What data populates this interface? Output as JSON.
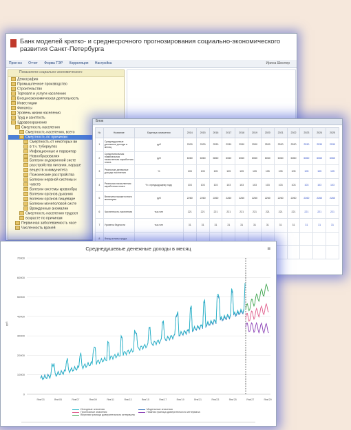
{
  "tree_window": {
    "title": "Банк моделей кратко- и среднесрочного прогнозирования социально-экономического развития Санкт-Петербурга",
    "menu": [
      "Прогноз",
      "Отчет",
      "Форма ТЭР",
      "Корреляция",
      "Настройка"
    ],
    "user": "Ирина Шихлер",
    "tree_header": "Показатели социально-экономического",
    "nodes": [
      {
        "label": "Демография",
        "level": 0
      },
      {
        "label": "Промышленное производство",
        "level": 0
      },
      {
        "label": "Строительство",
        "level": 0
      },
      {
        "label": "Торговля и услуги населению",
        "level": 0
      },
      {
        "label": "Внешнеэкономическая деятельность",
        "level": 0
      },
      {
        "label": "Инвестиции",
        "level": 0
      },
      {
        "label": "Финансы",
        "level": 0
      },
      {
        "label": "Уровень жизни населения",
        "level": 0
      },
      {
        "label": "Труд и занятость",
        "level": 0
      },
      {
        "label": "Здравоохранение",
        "level": 0
      },
      {
        "label": "Смертность населения",
        "level": 1
      },
      {
        "label": "Смертность населения, всего",
        "level": 2
      },
      {
        "label": "Смертность по причинам",
        "level": 2,
        "selected": true
      },
      {
        "label": "Смертность от некоторых ви",
        "level": 3
      },
      {
        "label": "в т.ч. туберкулез",
        "level": 3
      },
      {
        "label": "Инфекционные и паразитар",
        "level": 3
      },
      {
        "label": "Новообразования",
        "level": 3
      },
      {
        "label": "Болезни эндокринной систе",
        "level": 3
      },
      {
        "label": "расстройства питания, наруше",
        "level": 3
      },
      {
        "label": "веществ и иммунитета",
        "level": 3
      },
      {
        "label": "Психические расстройства",
        "level": 3
      },
      {
        "label": "Болезни нервной системы и",
        "level": 3
      },
      {
        "label": "чувств",
        "level": 3
      },
      {
        "label": "Болезни системы кровообра",
        "level": 3
      },
      {
        "label": "Болезни органов дыхания",
        "level": 3
      },
      {
        "label": "Болезни органов пищеваре",
        "level": 3
      },
      {
        "label": "Болезни мочеполовой систе",
        "level": 3
      },
      {
        "label": "Врожденные аномалии",
        "level": 3
      },
      {
        "label": "Смертность населения трудосп",
        "level": 2
      },
      {
        "label": "возрасте по причинам",
        "level": 2
      },
      {
        "label": "Первичная заболеваемость насе",
        "level": 1
      },
      {
        "label": "Численность врачей",
        "level": 1
      }
    ]
  },
  "table_window": {
    "header": "Блок",
    "columns": [
      "№",
      "Название",
      "Единица измерения",
      "2014",
      "2015",
      "2016",
      "2017",
      "2018",
      "2019",
      "2020",
      "2021",
      "2022",
      "2023",
      "2024",
      "2025"
    ],
    "rows": [
      {
        "n": "1",
        "name": "Среднедушевые денежные доходы в месяц",
        "unit": "руб",
        "vals": [
          "2530",
          "2530",
          "2530",
          "2530",
          "2530",
          "2530",
          "2530",
          "2530",
          "2530",
          "2530",
          "2530",
          "2530"
        ]
      },
      {
        "n": "2",
        "name": "Среднемесячная номинальная начисленная заработная плата",
        "unit": "руб",
        "vals": [
          "6060",
          "6060",
          "6060",
          "6060",
          "6060",
          "6060",
          "6060",
          "6060",
          "6060",
          "6060",
          "6060",
          "6060"
        ]
      },
      {
        "n": "3",
        "name": "Реальные денежные доходы населения",
        "unit": "%",
        "vals": [
          "105",
          "105",
          "105",
          "105",
          "105",
          "105",
          "105",
          "105",
          "105",
          "105",
          "105",
          "105"
        ]
      },
      {
        "n": "4",
        "name": "Реальная начисленная заработная плата",
        "unit": "% к предыдущему году",
        "vals": [
          "103",
          "103",
          "103",
          "103",
          "103",
          "103",
          "103",
          "103",
          "103",
          "103",
          "103",
          "103"
        ]
      },
      {
        "n": "5",
        "name": "Величина прожиточного минимума",
        "unit": "руб",
        "vals": [
          "2260",
          "2260",
          "2260",
          "2260",
          "2260",
          "2260",
          "2260",
          "2260",
          "2260",
          "2260",
          "2260",
          "2260"
        ]
      },
      {
        "n": "6",
        "name": "Численность населения",
        "unit": "тыс.чел",
        "vals": [
          "221",
          "221",
          "221",
          "221",
          "221",
          "221",
          "221",
          "221",
          "221",
          "221",
          "221",
          "221"
        ]
      },
      {
        "n": "7",
        "name": "Уровень бедности",
        "unit": "тыс.чел",
        "vals": [
          "31",
          "31",
          "31",
          "31",
          "31",
          "31",
          "31",
          "31",
          "31",
          "31",
          "31",
          "31"
        ]
      },
      {
        "n": "8",
        "name": "Фонд оплаты труда",
        "unit": "",
        "vals": [
          "",
          "",
          "",
          "",
          "",
          "",
          "",
          "",
          "",
          "",
          "",
          ""
        ]
      },
      {
        "n": "9",
        "name": "Пенсии",
        "unit": "",
        "vals": [
          "",
          "",
          "",
          "",
          "",
          "",
          "",
          "",
          "",
          "",
          "",
          ""
        ]
      }
    ]
  },
  "chart_window": {
    "menu_icon": "menu-icon",
    "chart_data": {
      "type": "line",
      "title": "Среднедушевые денежные доходы в месяц",
      "ylabel": "руб",
      "ylim": [
        0,
        70000
      ],
      "yticks": [
        "0",
        "10000",
        "20000",
        "30000",
        "40000",
        "50000",
        "60000",
        "70000"
      ],
      "xticks": [
        "Янв'03",
        "Янв'05",
        "Янв'07",
        "Янв'09",
        "Янв'11",
        "Янв'13",
        "Янв'15",
        "Янв'17",
        "Янв'19",
        "Янв'21",
        "Янв'23",
        "Янв'25",
        "Янв'27",
        "Янв'29"
      ],
      "series": [
        {
          "name": "Исходные значения",
          "color": "#2bb7c9"
        },
        {
          "name": "Модельные значения",
          "color": "#2f6fb8"
        },
        {
          "name": "Прогнозные значения",
          "color": "#e05b8a"
        },
        {
          "name": "Нижняя граница доверительного интервала",
          "color": "#8a3fb5"
        },
        {
          "name": "Верхняя граница доверительного интервала",
          "color": "#3ca34c"
        }
      ]
    }
  }
}
